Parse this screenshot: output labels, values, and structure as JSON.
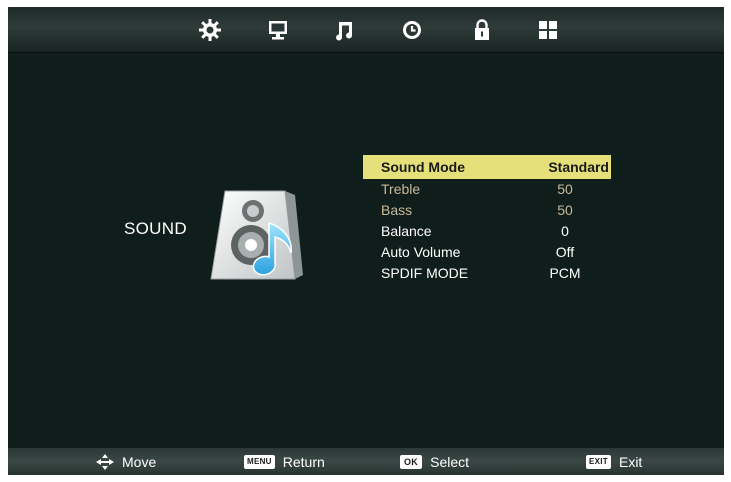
{
  "tabs": [
    {
      "id": "picture",
      "icon": "gear-icon"
    },
    {
      "id": "screen",
      "icon": "monitor-icon"
    },
    {
      "id": "sound",
      "icon": "music-note-icon",
      "active": true
    },
    {
      "id": "time",
      "icon": "clock-icon"
    },
    {
      "id": "lock",
      "icon": "padlock-icon"
    },
    {
      "id": "setup",
      "icon": "grid-icon"
    }
  ],
  "section": {
    "title": "SOUND",
    "icon": "speaker-music-icon"
  },
  "menu": {
    "items": [
      {
        "label": "Sound Mode",
        "value": "Standard",
        "state": "selected"
      },
      {
        "label": "Treble",
        "value": "50",
        "state": "disabled"
      },
      {
        "label": "Bass",
        "value": "50",
        "state": "disabled"
      },
      {
        "label": "Balance",
        "value": "0",
        "state": "normal"
      },
      {
        "label": "Auto Volume",
        "value": "Off",
        "state": "normal"
      },
      {
        "label": "SPDIF MODE",
        "value": "PCM",
        "state": "normal"
      }
    ]
  },
  "footer": {
    "move": {
      "label": "Move",
      "icon": "move-arrows-icon"
    },
    "return": {
      "key": "MENU",
      "label": "Return"
    },
    "select": {
      "key": "OK",
      "label": "Select"
    },
    "exit": {
      "key": "EXIT",
      "label": "Exit"
    }
  },
  "colors": {
    "background": "#0f1e1b",
    "highlight": "#e6e07a",
    "disabled_text": "#c9b89a"
  }
}
